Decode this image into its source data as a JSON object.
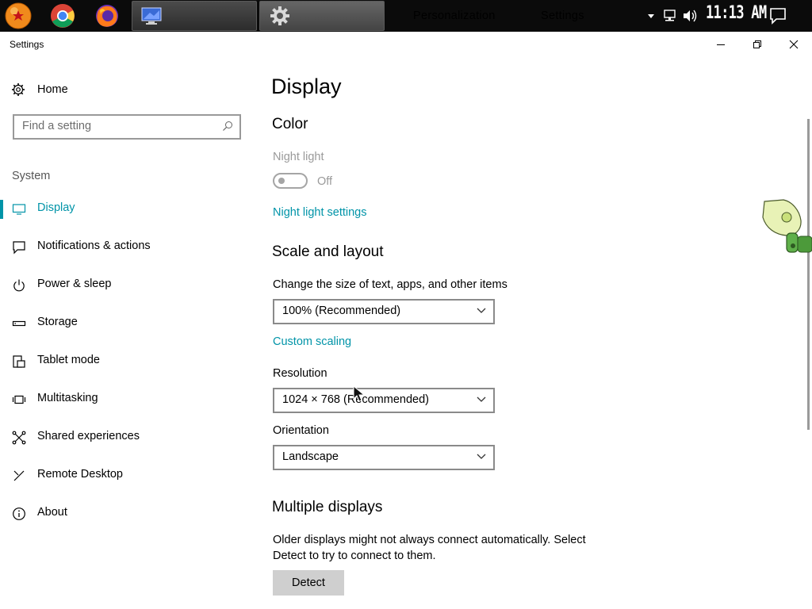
{
  "taskbar": {
    "apps": [
      {
        "name": "Personalization"
      },
      {
        "name": "Settings"
      }
    ],
    "clock": "11:13 AM"
  },
  "window": {
    "title": "Settings"
  },
  "sidebar": {
    "home_label": "Home",
    "search_placeholder": "Find a setting",
    "section_header": "System",
    "items": [
      {
        "label": "Display",
        "icon": "monitor-icon",
        "selected": true
      },
      {
        "label": "Notifications & actions",
        "icon": "notification-icon"
      },
      {
        "label": "Power & sleep",
        "icon": "power-icon"
      },
      {
        "label": "Storage",
        "icon": "storage-icon"
      },
      {
        "label": "Tablet mode",
        "icon": "tablet-icon"
      },
      {
        "label": "Multitasking",
        "icon": "multitasking-icon"
      },
      {
        "label": "Shared experiences",
        "icon": "share-icon"
      },
      {
        "label": "Remote Desktop",
        "icon": "remote-desktop-icon"
      },
      {
        "label": "About",
        "icon": "info-icon"
      }
    ]
  },
  "main": {
    "page_title": "Display",
    "color": {
      "heading": "Color",
      "night_light_label": "Night light",
      "night_light_state": "Off",
      "night_light_link": "Night light settings"
    },
    "scale": {
      "heading": "Scale and layout",
      "size_label": "Change the size of text, apps, and other items",
      "size_value": "100% (Recommended)",
      "custom_link": "Custom scaling",
      "resolution_label": "Resolution",
      "resolution_value": "1024 × 768 (Recommended)",
      "orientation_label": "Orientation",
      "orientation_value": "Landscape"
    },
    "multiple": {
      "heading": "Multiple displays",
      "desc_line1": "Older displays might not always connect automatically. Select",
      "desc_line2": "Detect to try to connect to them.",
      "detect_label": "Detect"
    }
  },
  "colors": {
    "accent": "#0094a8",
    "taskbar": "#0b0b0b"
  }
}
